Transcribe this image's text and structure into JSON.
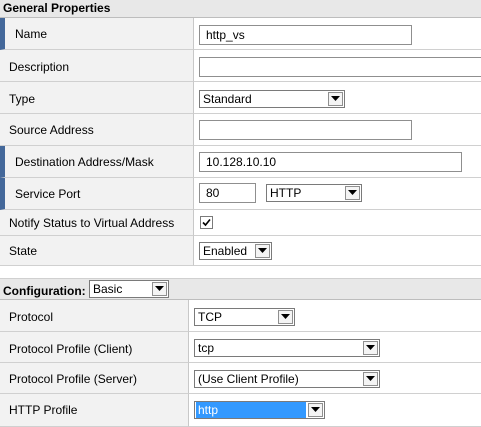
{
  "general": {
    "title": "General Properties",
    "name": {
      "label": "Name",
      "value": "http_vs"
    },
    "description": {
      "label": "Description",
      "value": ""
    },
    "type": {
      "label": "Type",
      "value": "Standard"
    },
    "source_address": {
      "label": "Source Address",
      "value": ""
    },
    "destination": {
      "label": "Destination Address/Mask",
      "value": "10.128.10.10"
    },
    "service_port": {
      "label": "Service Port",
      "value": "80",
      "service": "HTTP"
    },
    "notify": {
      "label": "Notify Status to Virtual Address",
      "checked": true
    },
    "state": {
      "label": "State",
      "value": "Enabled"
    }
  },
  "configuration": {
    "title": "Configuration:",
    "mode": "Basic",
    "protocol": {
      "label": "Protocol",
      "value": "TCP"
    },
    "profile_client": {
      "label": "Protocol Profile (Client)",
      "value": "tcp"
    },
    "profile_server": {
      "label": "Protocol Profile (Server)",
      "value": "(Use Client Profile)"
    },
    "http_profile": {
      "label": "HTTP Profile",
      "value": "http"
    }
  },
  "colors": {
    "required_marker": "#44689a",
    "header_bg": "#e8e8e8",
    "label_bg": "#f2f2f2",
    "highlight": "#3399ff"
  }
}
